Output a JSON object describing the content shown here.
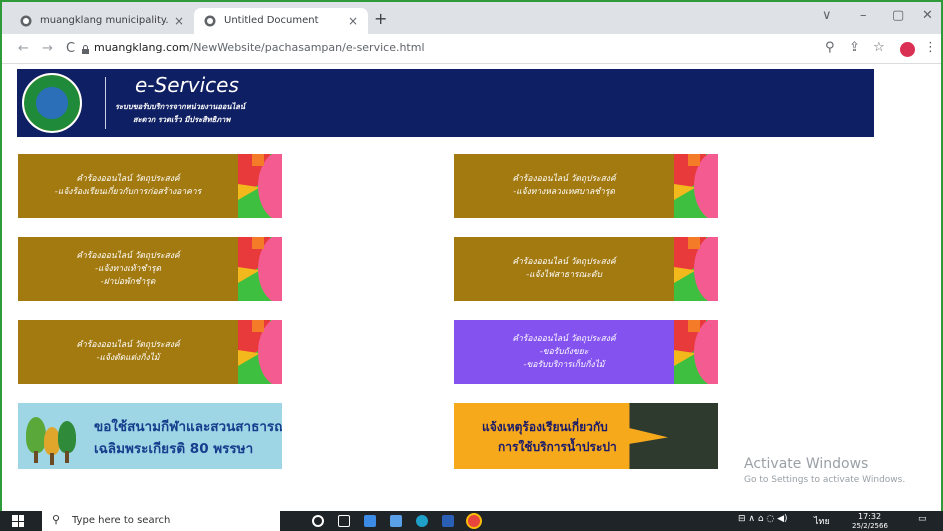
{
  "browser": {
    "tabs": [
      {
        "title": "muangklang municipality.",
        "close": "×"
      },
      {
        "title": "Untitled Document",
        "close": "×"
      }
    ],
    "new_tab": "+",
    "window_controls": [
      "∨",
      "–",
      "▢",
      "✕"
    ],
    "url_host": "muangklang.com",
    "url_path": "/NewWebsite/pachasampan/e-service.html",
    "nav": {
      "back": "←",
      "forward": "→",
      "reload": "C"
    },
    "icons": [
      "search-icon",
      "share-icon",
      "star-icon",
      "menu-icon"
    ]
  },
  "header": {
    "title": "e-Services",
    "subtitle1": "ระบบขอรับบริการจากหน่วยงานออนไลน์",
    "subtitle2": "สะดวก รวดเร็ว มีประสิทธิภาพ"
  },
  "cards": [
    {
      "lines": [
        "คำร้องออนไลน์ วัตถุประสงค์",
        "-แจ้งร้องเรียนเกี่ยวกับการก่อสร้างอาคาร"
      ]
    },
    {
      "lines": [
        "คำร้องออนไลน์ วัตถุประสงค์",
        "-แจ้งทางหลวงเทศบาลชำรุด"
      ]
    },
    {
      "lines": [
        "คำร้องออนไลน์ วัตถุประสงค์",
        "-แจ้งทางเท้าชำรุด",
        "-ฝาบ่อพักชำรุด"
      ]
    },
    {
      "lines": [
        "คำร้องออนไลน์ วัตถุประสงค์",
        "-แจ้งไฟสาธารณะดับ"
      ]
    },
    {
      "lines": [
        "คำร้องออนไลน์ วัตถุประสงค์",
        "-แจ้งตัดแต่งกิ่งไม้"
      ]
    },
    {
      "lines": [
        "คำร้องออนไลน์ วัตถุประสงค์",
        "-ขอรับถังขยะ",
        "-ขอรับบริการเก็บกิ่งไม้"
      ]
    }
  ],
  "banners": {
    "left": {
      "line1": "ขอใช้สนามกีฬาและสวนสาธารณะ",
      "line2": "เฉลิมพระเกียรติ 80 พรรษา"
    },
    "right": {
      "line1": "แจ้งเหตุร้องเรียนเกี่ยวกับ",
      "line2": "การใช้บริการน้ำประปา"
    }
  },
  "watermark": {
    "line1": "Activate Windows",
    "line2": "Go to Settings to activate Windows."
  },
  "taskbar": {
    "search_placeholder": "Type here to search",
    "time": "17:32",
    "date": "25/2/2566",
    "lang": "ไทย"
  },
  "colors": {
    "gold": "#a27a10",
    "purple": "#8452ee",
    "navy": "#0f1f63"
  }
}
